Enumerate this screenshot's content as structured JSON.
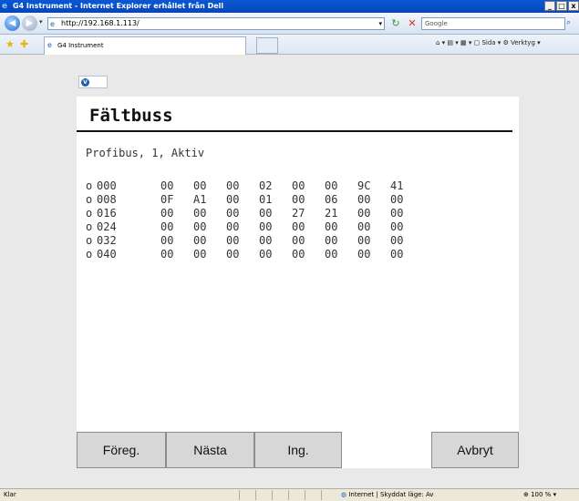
{
  "window": {
    "title": "G4 Instrument - Internet Explorer erhållet från Dell",
    "minimize": "_",
    "restore": "□",
    "close": "x"
  },
  "address": {
    "url": "http://192.168.1.113/",
    "search_placeholder": "Google"
  },
  "tabs": [
    {
      "label": "G4 Instrument"
    }
  ],
  "commandbar": {
    "page_label": "Sida",
    "tools_label": "Verktyg"
  },
  "page": {
    "heading": "Fältbuss",
    "status": "Profibus, 1, Aktiv",
    "rows": [
      {
        "radio": "o",
        "addr": "000",
        "cells": [
          "00",
          "00",
          "00",
          "02",
          "00",
          "00",
          "9C",
          "41"
        ]
      },
      {
        "radio": "o",
        "addr": "008",
        "cells": [
          "0F",
          "A1",
          "00",
          "01",
          "00",
          "06",
          "00",
          "00"
        ]
      },
      {
        "radio": "o",
        "addr": "016",
        "cells": [
          "00",
          "00",
          "00",
          "00",
          "27",
          "21",
          "00",
          "00"
        ]
      },
      {
        "radio": "o",
        "addr": "024",
        "cells": [
          "00",
          "00",
          "00",
          "00",
          "00",
          "00",
          "00",
          "00"
        ]
      },
      {
        "radio": "o",
        "addr": "032",
        "cells": [
          "00",
          "00",
          "00",
          "00",
          "00",
          "00",
          "00",
          "00"
        ]
      },
      {
        "radio": "o",
        "addr": "040",
        "cells": [
          "00",
          "00",
          "00",
          "00",
          "00",
          "00",
          "00",
          "00"
        ]
      }
    ],
    "buttons": {
      "prev": "Föreg.",
      "next": "Nästa",
      "ing": "Ing.",
      "cancel": "Avbryt"
    }
  },
  "statusbar": {
    "left": "Klar",
    "zone": "Internet | Skyddat läge: Av",
    "zoom": "100 %"
  },
  "colors": {
    "titlebar": "#0646b8",
    "panel_bg": "#ffffff",
    "page_bg": "#e9e9e9",
    "button_bg": "#d7d7d7"
  }
}
